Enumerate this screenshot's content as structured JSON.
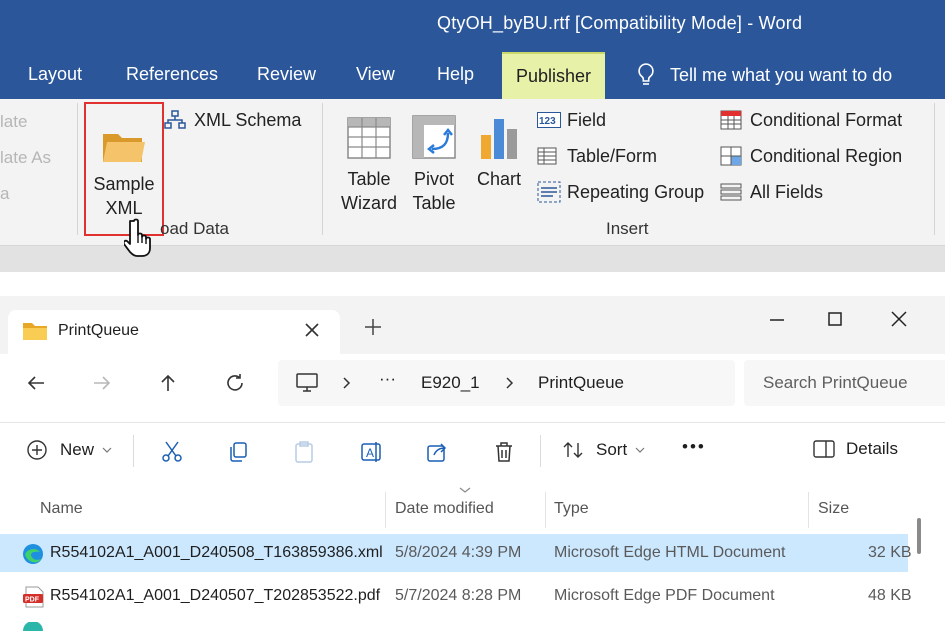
{
  "word": {
    "window_title": "QtyOH_byBU.rtf [Compatibility Mode]  -  Word",
    "tabs": [
      "Layout",
      "References",
      "Review",
      "View",
      "Help",
      "Publisher"
    ],
    "active_tab": "Publisher",
    "tell_me": "Tell me what you want to do",
    "partial_items": [
      "late",
      "late As",
      "a"
    ],
    "load_data": {
      "sample_xml": "Sample XML",
      "sample_xml_line1": "Sample",
      "sample_xml_line2": "XML",
      "xml_schema": "XML Schema",
      "group_label": "Load Data",
      "group_label_visible": "oad Data"
    },
    "insert": {
      "table_wizard_line1": "Table",
      "table_wizard_line2": "Wizard",
      "pivot_table_line1": "Pivot",
      "pivot_table_line2": "Table",
      "chart": "Chart",
      "field": "Field",
      "table_form": "Table/Form",
      "repeating_group": "Repeating Group",
      "conditional_format": "Conditional Format",
      "conditional_region": "Conditional Region",
      "all_fields": "All Fields",
      "group_label": "Insert"
    },
    "colors": {
      "title_bar": "#2b579a",
      "publisher_tab": "#e7f2a8",
      "highlight_border": "#e0302f"
    }
  },
  "explorer": {
    "tab_title": "PrintQueue",
    "address": {
      "more": "···",
      "parent": "E920_1",
      "current": "PrintQueue"
    },
    "search_placeholder": "Search PrintQueue",
    "toolbar": {
      "new": "New",
      "sort": "Sort",
      "more": "•••",
      "details": "Details"
    },
    "columns": [
      "Name",
      "Date modified",
      "Type",
      "Size"
    ],
    "files": [
      {
        "name": "R554102A1_A001_D240508_T163859386.xml",
        "date": "5/8/2024 4:39 PM",
        "type": "Microsoft Edge HTML Document",
        "size": "32 KB",
        "selected": true,
        "icon": "edge-icon"
      },
      {
        "name": "R554102A1_A001_D240507_T202853522.pdf",
        "date": "5/7/2024 8:28 PM",
        "type": "Microsoft Edge PDF Document",
        "size": "48 KB",
        "selected": false,
        "icon": "pdf-icon"
      }
    ],
    "colors": {
      "selected_row": "#cce8ff"
    }
  }
}
